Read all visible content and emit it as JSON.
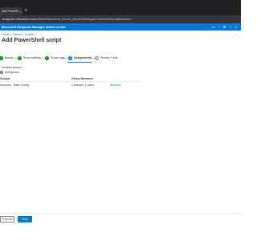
{
  "browser": {
    "tab_title": "Add PowerShell script - Micro",
    "tab_close": "×",
    "new_tab": "+",
    "url_host": "endpoint.microsoft.com",
    "url_path": "/#blade/Microsoft_Intune_DeviceSettings/PowershellScriptsWizard..."
  },
  "portal": {
    "title": "Microsoft Endpoint Manager admin center",
    "icons": [
      "terminal-icon",
      "bell-icon",
      "gear-icon",
      "help-icon",
      "feedback-icon"
    ]
  },
  "breadcrumb": "Home > Devices | Scripts >",
  "page": {
    "title": "Add PowerShell script",
    "more": "···"
  },
  "steps": [
    {
      "label": "Basics",
      "glyph": "✓"
    },
    {
      "label": "Script settings",
      "glyph": "✓"
    },
    {
      "label": "Scope tags",
      "glyph": "✓"
    },
    {
      "label": "Assignments",
      "glyph": "4"
    },
    {
      "label": "Review + add",
      "glyph": "5"
    }
  ],
  "included": {
    "section_label": "Included groups",
    "add_label": "Add groups"
  },
  "table": {
    "headers": [
      "Groups",
      "Group Members"
    ],
    "rows": [
      {
        "group": "Autopilot - Base Config",
        "members": "0 devices, 1 users",
        "action": "Remove"
      }
    ]
  },
  "footer": {
    "previous": "Previous",
    "next": "Next"
  },
  "colors": {
    "accent": "#0078d4",
    "done": "#107c10"
  }
}
